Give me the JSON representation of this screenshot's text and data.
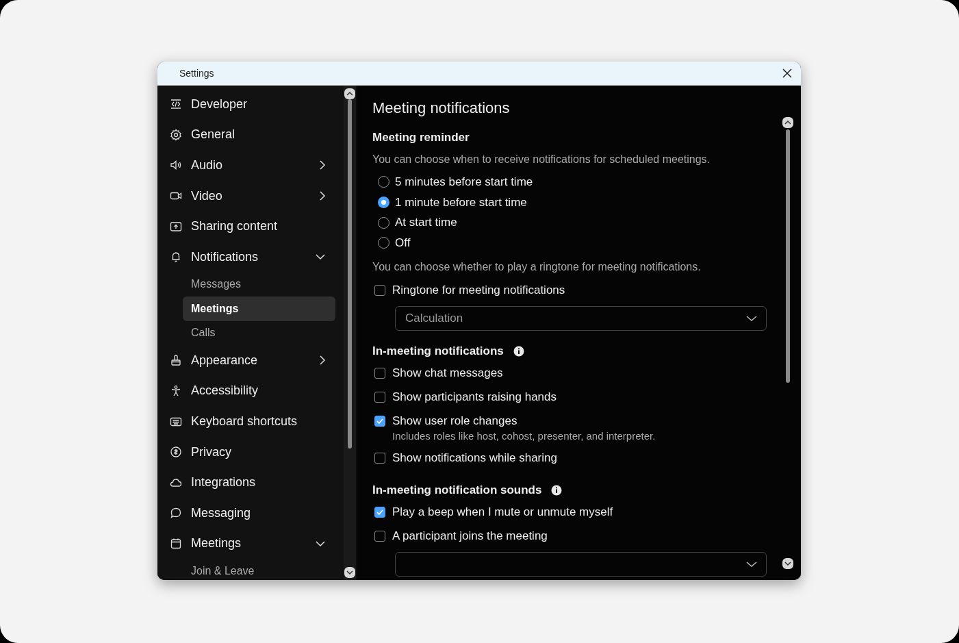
{
  "window": {
    "title": "Settings"
  },
  "sidebar": {
    "items": [
      {
        "label": "Developer"
      },
      {
        "label": "General"
      },
      {
        "label": "Audio",
        "expanded": false
      },
      {
        "label": "Video",
        "expanded": false
      },
      {
        "label": "Sharing content"
      },
      {
        "label": "Notifications",
        "expanded": true,
        "children": [
          {
            "label": "Messages",
            "selected": false
          },
          {
            "label": "Meetings",
            "selected": true
          },
          {
            "label": "Calls",
            "selected": false
          }
        ]
      },
      {
        "label": "Appearance",
        "expanded": false
      },
      {
        "label": "Accessibility"
      },
      {
        "label": "Keyboard shortcuts"
      },
      {
        "label": "Privacy"
      },
      {
        "label": "Integrations"
      },
      {
        "label": "Messaging"
      },
      {
        "label": "Meetings",
        "expanded": true,
        "children": [
          {
            "label": "Join & Leave",
            "selected": false
          }
        ]
      }
    ]
  },
  "content": {
    "title": "Meeting notifications",
    "sections": [
      {
        "heading": "Meeting reminder",
        "info": false,
        "blocks": [
          {
            "kind": "text",
            "text": "You can choose when to receive notifications for scheduled meetings."
          },
          {
            "kind": "radio",
            "options": [
              {
                "label": "5 minutes before start time",
                "selected": false
              },
              {
                "label": "1 minute before start time",
                "selected": true
              },
              {
                "label": "At start time",
                "selected": false
              },
              {
                "label": "Off",
                "selected": false
              }
            ]
          },
          {
            "kind": "text",
            "text": "You can choose whether to play a ringtone for meeting notifications."
          },
          {
            "kind": "checkbox",
            "label": "Ringtone for meeting notifications",
            "checked": false
          },
          {
            "kind": "dropdown",
            "value": "Calculation"
          }
        ]
      },
      {
        "heading": "In-meeting notifications",
        "info": true,
        "blocks": [
          {
            "kind": "checkbox",
            "label": "Show chat messages",
            "checked": false
          },
          {
            "kind": "checkbox",
            "label": "Show participants raising hands",
            "checked": false
          },
          {
            "kind": "checkbox",
            "label": "Show user role changes",
            "checked": true,
            "note": "Includes roles like host, cohost, presenter, and interpreter."
          },
          {
            "kind": "checkbox",
            "label": "Show notifications while sharing",
            "checked": false
          }
        ]
      },
      {
        "heading": "In-meeting notification sounds",
        "info": true,
        "blocks": [
          {
            "kind": "checkbox",
            "label": "Play a beep when I mute or unmute myself",
            "checked": true
          },
          {
            "kind": "checkbox",
            "label": "A participant joins the meeting",
            "checked": false
          },
          {
            "kind": "dropdown"
          }
        ]
      }
    ]
  }
}
